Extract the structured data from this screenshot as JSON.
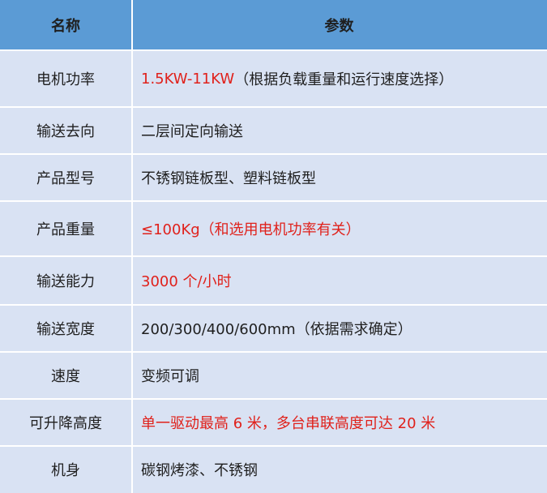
{
  "header": {
    "name": "名称",
    "param": "参数"
  },
  "rows": [
    {
      "name": "电机功率",
      "value_red": "1.5KW-11KW",
      "value_dark": "（根据负载重量和运行速度选择）"
    },
    {
      "name": "输送去向",
      "value_red": "",
      "value_dark": "二层间定向输送"
    },
    {
      "name": "产品型号",
      "value_red": "",
      "value_dark": "不锈钢链板型、塑料链板型"
    },
    {
      "name": "产品重量",
      "value_red": "≤100Kg（和选用电机功率有关）",
      "value_dark": ""
    },
    {
      "name": "输送能力",
      "value_red": "3000 个/小时",
      "value_dark": ""
    },
    {
      "name": "输送宽度",
      "value_red": "",
      "value_dark": "200/300/400/600mm（依据需求确定）"
    },
    {
      "name": "速度",
      "value_red": "",
      "value_dark": "变频可调"
    },
    {
      "name": "可升降高度",
      "value_red": "单一驱动最高 6 米，多台串联高度可达 20 米",
      "value_dark": ""
    },
    {
      "name": "机身",
      "value_red": "",
      "value_dark": "碳钢烤漆、不锈钢"
    }
  ],
  "colors": {
    "header": "#5b9bd5",
    "row": "#d9e2f3",
    "highlight": "#e0211b"
  }
}
